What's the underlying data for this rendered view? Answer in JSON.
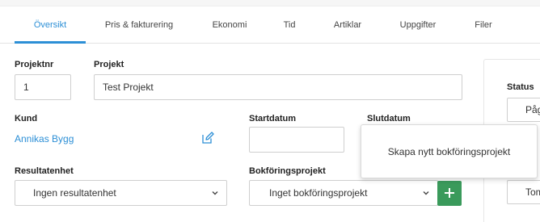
{
  "tabs": [
    {
      "label": "Översikt",
      "active": true
    },
    {
      "label": "Pris & fakturering",
      "active": false
    },
    {
      "label": "Ekonomi",
      "active": false
    },
    {
      "label": "Tid",
      "active": false
    },
    {
      "label": "Artiklar",
      "active": false
    },
    {
      "label": "Uppgifter",
      "active": false
    },
    {
      "label": "Filer",
      "active": false
    }
  ],
  "form": {
    "projektnr_label": "Projektnr",
    "projektnr_value": "1",
    "projekt_label": "Projekt",
    "projekt_value": "Test Projekt",
    "kund_label": "Kund",
    "kund_value": "Annikas Bygg",
    "startdatum_label": "Startdatum",
    "startdatum_value": "",
    "slutdatum_label": "Slutdatum",
    "resultatenhet_label": "Resultatenhet",
    "resultatenhet_value": "Ingen resultatenhet",
    "bokforingsprojekt_label": "Bokföringsprojekt",
    "bokforingsprojekt_value": "Inget bokföringsprojekt"
  },
  "right_panel": {
    "status_label": "Status",
    "status_value": "Påg",
    "row2_value": "Tom"
  },
  "tooltip": {
    "text": "Skapa nytt bokföringsprojekt"
  },
  "colors": {
    "accent": "#2c8fd6",
    "add_button": "#3a9a5b"
  }
}
